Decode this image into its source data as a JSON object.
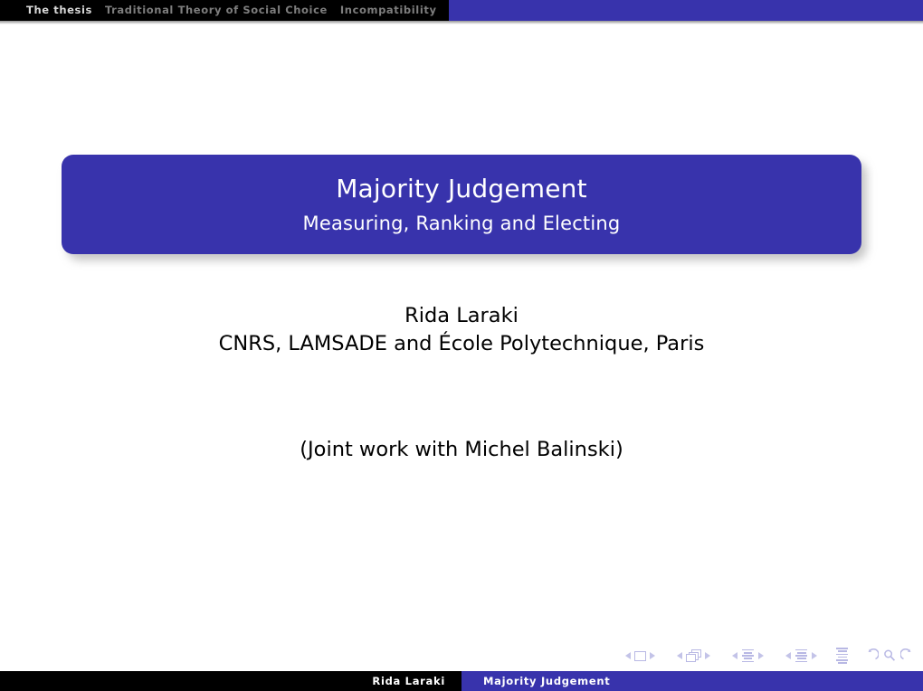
{
  "headline": {
    "sections": [
      {
        "label": "The thesis",
        "state": "active"
      },
      {
        "label": "Traditional Theory of Social Choice",
        "state": "inactive"
      },
      {
        "label": "Incompatibility",
        "state": "inactive"
      }
    ],
    "bar_color": "#3833ac",
    "section_bg": "#000000"
  },
  "title_block": {
    "title": "Majority Judgement",
    "subtitle": "Measuring, Ranking and Electing",
    "background_color": "#3833ac",
    "text_color": "#ffffff"
  },
  "author": {
    "name": "Rida Laraki",
    "affiliation": "CNRS, LAMSADE and École Polytechnique, Paris"
  },
  "note": {
    "joint_work": "(Joint work with Michel Balinski)"
  },
  "navigation": {
    "color": "#b8b8e4",
    "groups": [
      {
        "name": "slide",
        "prev": "◄",
        "glyph": "slide-icon",
        "next": "►"
      },
      {
        "name": "frame",
        "prev": "◄",
        "glyph": "frame-icon",
        "next": "►"
      },
      {
        "name": "subsection",
        "prev": "◄",
        "glyph": "subsection-icon",
        "next": "►"
      },
      {
        "name": "section",
        "prev": "◄",
        "glyph": "section-icon",
        "next": "►"
      },
      {
        "name": "document",
        "glyph": "document-icon"
      },
      {
        "name": "back",
        "glyph": "back-arrow-icon"
      },
      {
        "name": "find",
        "glyph": "search-icon"
      },
      {
        "name": "forward",
        "glyph": "forward-arrow-icon"
      }
    ]
  },
  "footline": {
    "author": "Rida Laraki",
    "title": "Majority Judgement",
    "author_bg": "#000000",
    "title_bg": "#3833ac"
  }
}
